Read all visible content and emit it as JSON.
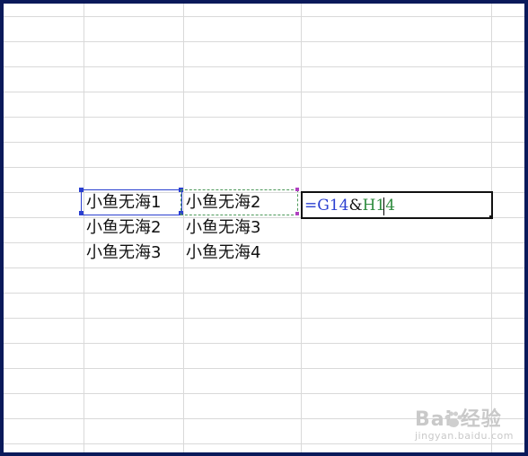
{
  "sheet": {
    "cells": {
      "G14": "小鱼无海1",
      "H14": "小鱼无海2",
      "G15": "小鱼无海2",
      "H15": "小鱼无海3",
      "G16": "小鱼无海3",
      "H16": "小鱼无海4"
    },
    "editing_cell": {
      "formula_prefix": "=",
      "ref1": "G14",
      "operator": "&",
      "ref2": "H14"
    },
    "colors": {
      "ref1": "#2a3fd0",
      "ref2": "#2e8b3e",
      "selection": "#2a3fd0",
      "frame": "#0a1a5a"
    }
  },
  "watermark": {
    "main": "Bai  经验",
    "sub": "jingyan.baidu.com",
    "icon": "paw-icon"
  }
}
